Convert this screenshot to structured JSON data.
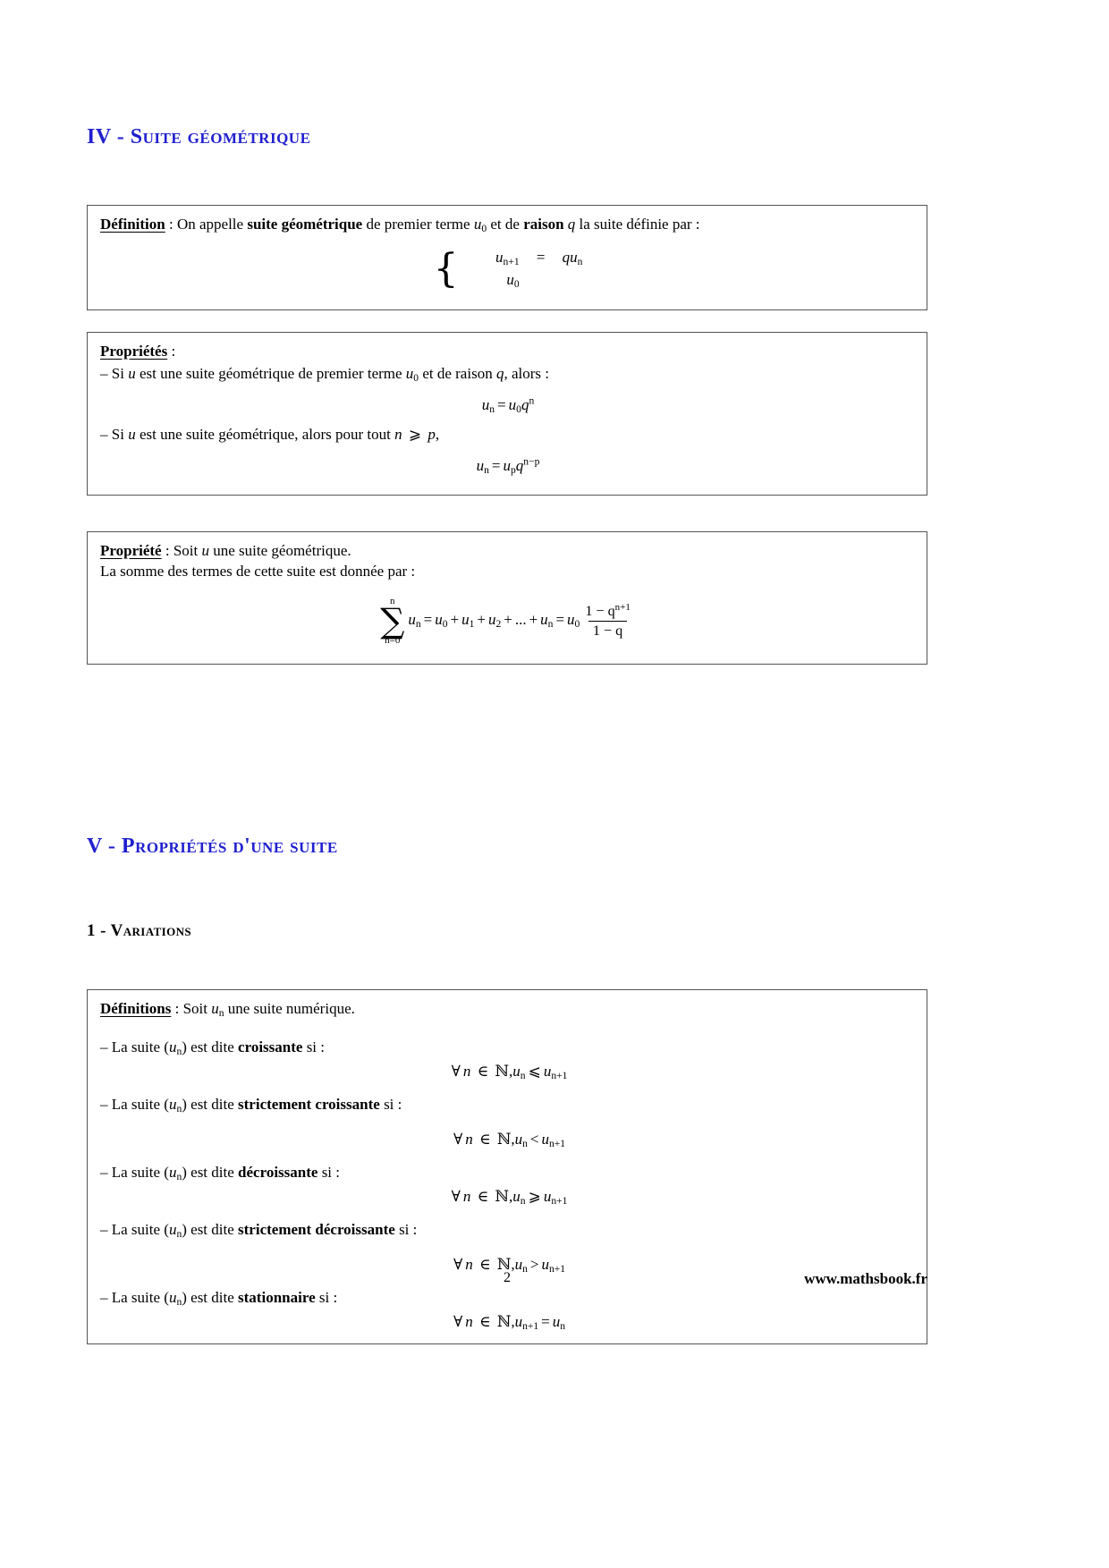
{
  "document": {
    "language": "fr",
    "heading_color": "#2020d0",
    "page_number": "2",
    "site": "www.mathsbook.fr"
  },
  "section_iv": {
    "number": "IV",
    "separator": "-",
    "title": "Suite géométrique",
    "full_heading": "IV - Suite géométrique"
  },
  "definition_box": {
    "title": "Définition",
    "colon": " : ",
    "text_1": "On appelle ",
    "bold_1": "suite géométrique",
    "text_2": " de premier terme ",
    "math_u0": "u",
    "math_u0_sub": "0",
    "text_3": " et de ",
    "bold_2": "raison",
    "math_q": "q",
    "text_4": " la suite définie par :",
    "system": {
      "line1_lhs_base": "u",
      "line1_lhs_sub": "n+1",
      "line1_op": "=",
      "line1_rhs": "qu",
      "line1_rhs_sub": "n",
      "line2_lhs_base": "u",
      "line2_lhs_sub": "0"
    }
  },
  "properties_box": {
    "title": "Propriétés",
    "colon": " :",
    "items": [
      {
        "dash": "–",
        "text_before": " Si ",
        "var": "u",
        "text_mid": " est une suite géométrique de premier terme ",
        "u_base": "u",
        "u_sub": "0",
        "text_mid2": " et de raison ",
        "q": "q",
        "text_after": ", alors :",
        "formula": "u_n = u_0 q^n"
      },
      {
        "dash": "–",
        "text_before": " Si ",
        "var": "u",
        "text_mid": " est une suite géométrique, alors pour tout ",
        "n": "n",
        "rel": "⩾",
        "p": "p",
        "text_after": ",",
        "formula": "u_n = u_p q^{n-p}"
      }
    ]
  },
  "sum_box": {
    "title": "Propriété",
    "colon": " : ",
    "line1_text": "Soit ",
    "line1_var": "u",
    "line1_rest": " une suite géométrique.",
    "line2": "La somme des termes de cette suite est donnée par :",
    "formula": {
      "sum_upper": "n",
      "sum_lower": "n=0",
      "summand_base": "u",
      "summand_sub": "n",
      "eq1": "=",
      "terms": "u₀ + u₁ + u₂ + ... + uₙ",
      "t0_base": "u",
      "t0_sub": "0",
      "t1_base": "u",
      "t1_sub": "1",
      "t2_base": "u",
      "t2_sub": "2",
      "ellipsis": "...",
      "tn_base": "u",
      "tn_sub": "n",
      "eq2": "=",
      "coef_base": "u",
      "coef_sub": "0",
      "frac_num": "1 − q",
      "frac_num_sup": "n+1",
      "frac_den": "1 − q"
    }
  },
  "section_v": {
    "number": "V",
    "separator": "-",
    "title": "Propriétés d'une suite",
    "full_heading": "V - Propriétés d’une suite"
  },
  "subsection_1": {
    "number": "1",
    "separator": "-",
    "title": "Variations",
    "full_heading": "1 - Variations"
  },
  "definitions_box": {
    "title": "Définitions",
    "colon": " : ",
    "intro_text": "Soit ",
    "intro_var_base": "u",
    "intro_var_sub": "n",
    "intro_rest": " une suite numérique.",
    "items": [
      {
        "dash": "–",
        "text_before": " La suite (",
        "seq_base": "u",
        "seq_sub": "n",
        "text_mid": ") est dite ",
        "bold": "croissante",
        "text_after": " si :",
        "formula_prefix": "∀",
        "formula_n": "n",
        "formula_in": "∈",
        "formula_set": "ℕ",
        "formula_comma": ",",
        "formula_lhs_base": "u",
        "formula_lhs_sub": "n",
        "formula_rel": "⩽",
        "formula_rhs_base": "u",
        "formula_rhs_sub": "n+1"
      },
      {
        "dash": "–",
        "text_before": " La suite (",
        "seq_base": "u",
        "seq_sub": "n",
        "text_mid": ") est dite ",
        "bold": "strictement croissante",
        "text_after": " si :",
        "formula_prefix": "∀",
        "formula_n": "n",
        "formula_in": "∈",
        "formula_set": "ℕ",
        "formula_comma": ",",
        "formula_lhs_base": "u",
        "formula_lhs_sub": "n",
        "formula_rel": "<",
        "formula_rhs_base": "u",
        "formula_rhs_sub": "n+1"
      },
      {
        "dash": "–",
        "text_before": " La suite (",
        "seq_base": "u",
        "seq_sub": "n",
        "text_mid": ") est dite ",
        "bold": "décroissante",
        "text_after": " si :",
        "formula_prefix": "∀",
        "formula_n": "n",
        "formula_in": "∈",
        "formula_set": "ℕ",
        "formula_comma": ",",
        "formula_lhs_base": "u",
        "formula_lhs_sub": "n",
        "formula_rel": "⩾",
        "formula_rhs_base": "u",
        "formula_rhs_sub": "n+1"
      },
      {
        "dash": "–",
        "text_before": " La suite (",
        "seq_base": "u",
        "seq_sub": "n",
        "text_mid": ") est dite ",
        "bold": "strictement décroissante",
        "text_after": " si :",
        "formula_prefix": "∀",
        "formula_n": "n",
        "formula_in": "∈",
        "formula_set": "ℕ",
        "formula_comma": ",",
        "formula_lhs_base": "u",
        "formula_lhs_sub": "n",
        "formula_rel": ">",
        "formula_rhs_base": "u",
        "formula_rhs_sub": "n+1"
      },
      {
        "dash": "–",
        "text_before": " La suite (",
        "seq_base": "u",
        "seq_sub": "n",
        "text_mid": ") est dite ",
        "bold": "stationnaire",
        "text_after": " si :",
        "formula_prefix": "∀",
        "formula_n": "n",
        "formula_in": "∈",
        "formula_set": "ℕ",
        "formula_comma": ",",
        "formula_lhs_base": "u",
        "formula_lhs_sub": "n+1",
        "formula_rel": "=",
        "formula_rhs_base": "u",
        "formula_rhs_sub": "n"
      }
    ]
  }
}
